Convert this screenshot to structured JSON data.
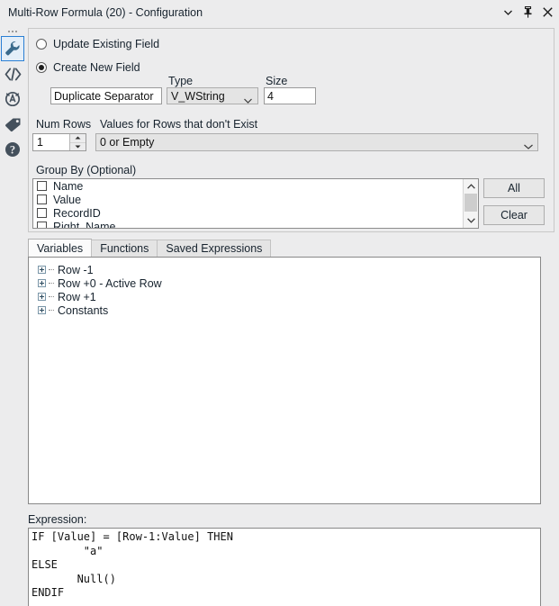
{
  "window": {
    "title": "Multi-Row Formula (20) - Configuration",
    "controls": [
      {
        "name": "menu-chevron",
        "glyph": "chevron-down-icon"
      },
      {
        "name": "pin",
        "glyph": "pin-icon"
      },
      {
        "name": "close",
        "glyph": "close-icon"
      }
    ]
  },
  "rail": {
    "items": [
      {
        "name": "configuration",
        "icon": "wrench-icon",
        "selected": true
      },
      {
        "name": "xml-view",
        "icon": "code-icon",
        "selected": false
      },
      {
        "name": "annotation",
        "icon": "circled-a-icon",
        "selected": false
      },
      {
        "name": "labels",
        "icon": "tag-icon",
        "selected": false
      },
      {
        "name": "help",
        "icon": "question-mark-icon",
        "selected": false
      }
    ]
  },
  "config": {
    "update_existing_label": "Update Existing Field",
    "update_existing_selected": false,
    "create_new_label": "Create New  Field",
    "create_new_selected": true,
    "field_name_value": "Duplicate Separator",
    "type_label": "Type",
    "type_value": "V_WString",
    "size_label": "Size",
    "size_value": "4",
    "num_rows_label": "Num Rows",
    "num_rows_value": "1",
    "missing_rows_label": "Values for Rows that don't Exist",
    "missing_rows_value": "0 or Empty",
    "group_by_label": "Group By (Optional)",
    "group_by_fields": [
      {
        "label": "Name",
        "checked": false
      },
      {
        "label": "Value",
        "checked": false
      },
      {
        "label": "RecordID",
        "checked": false
      },
      {
        "label": "Right_Name",
        "checked": false
      }
    ],
    "all_button": "All",
    "clear_button": "Clear"
  },
  "tabs": [
    {
      "label": "Variables",
      "active": true
    },
    {
      "label": "Functions",
      "active": false
    },
    {
      "label": "Saved Expressions",
      "active": false
    }
  ],
  "variables_tree": [
    {
      "label": "Row -1"
    },
    {
      "label": "Row +0 - Active Row"
    },
    {
      "label": "Row +1"
    },
    {
      "label": "Constants"
    }
  ],
  "expression": {
    "label": "Expression:",
    "text": "IF [Value] = [Row-1:Value] THEN\n        \"a\"\nELSE\n       Null()\nENDIF"
  },
  "colors": {
    "accent": "#2a7fd4",
    "panel": "#ececed",
    "field": "#ffffff",
    "disabled_field": "#e4e4e4",
    "text": "#17232e"
  }
}
